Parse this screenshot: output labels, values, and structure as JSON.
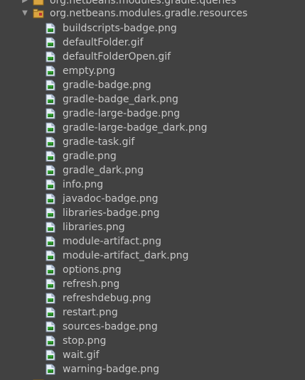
{
  "packages": {
    "top": {
      "label": "org.netbeans.modules.gradle.queries"
    },
    "open": {
      "label": "org.netbeans.modules.gradle.resources"
    }
  },
  "files": [
    "buildscripts-badge.png",
    "defaultFolder.gif",
    "defaultFolderOpen.gif",
    "empty.png",
    "gradle-badge.png",
    "gradle-badge_dark.png",
    "gradle-large-badge.png",
    "gradle-large-badge_dark.png",
    "gradle-task.gif",
    "gradle.png",
    "gradle_dark.png",
    "info.png",
    "javadoc-badge.png",
    "libraries-badge.png",
    "libraries.png",
    "module-artifact.png",
    "module-artifact_dark.png",
    "options.png",
    "refresh.png",
    "refreshdebug.png",
    "restart.png",
    "sources-badge.png",
    "stop.png",
    "wait.gif",
    "warning-badge.png"
  ],
  "icons": {
    "arrow_collapsed": "▶",
    "arrow_expanded": "▼",
    "package": "package-icon",
    "file": "image-file-icon"
  },
  "colors": {
    "background": "#414141",
    "text": "#c8c8c8",
    "package_icon": "#d9a441",
    "file_icon_paper": "#e6eef7",
    "file_icon_image": "#3cab3c"
  }
}
